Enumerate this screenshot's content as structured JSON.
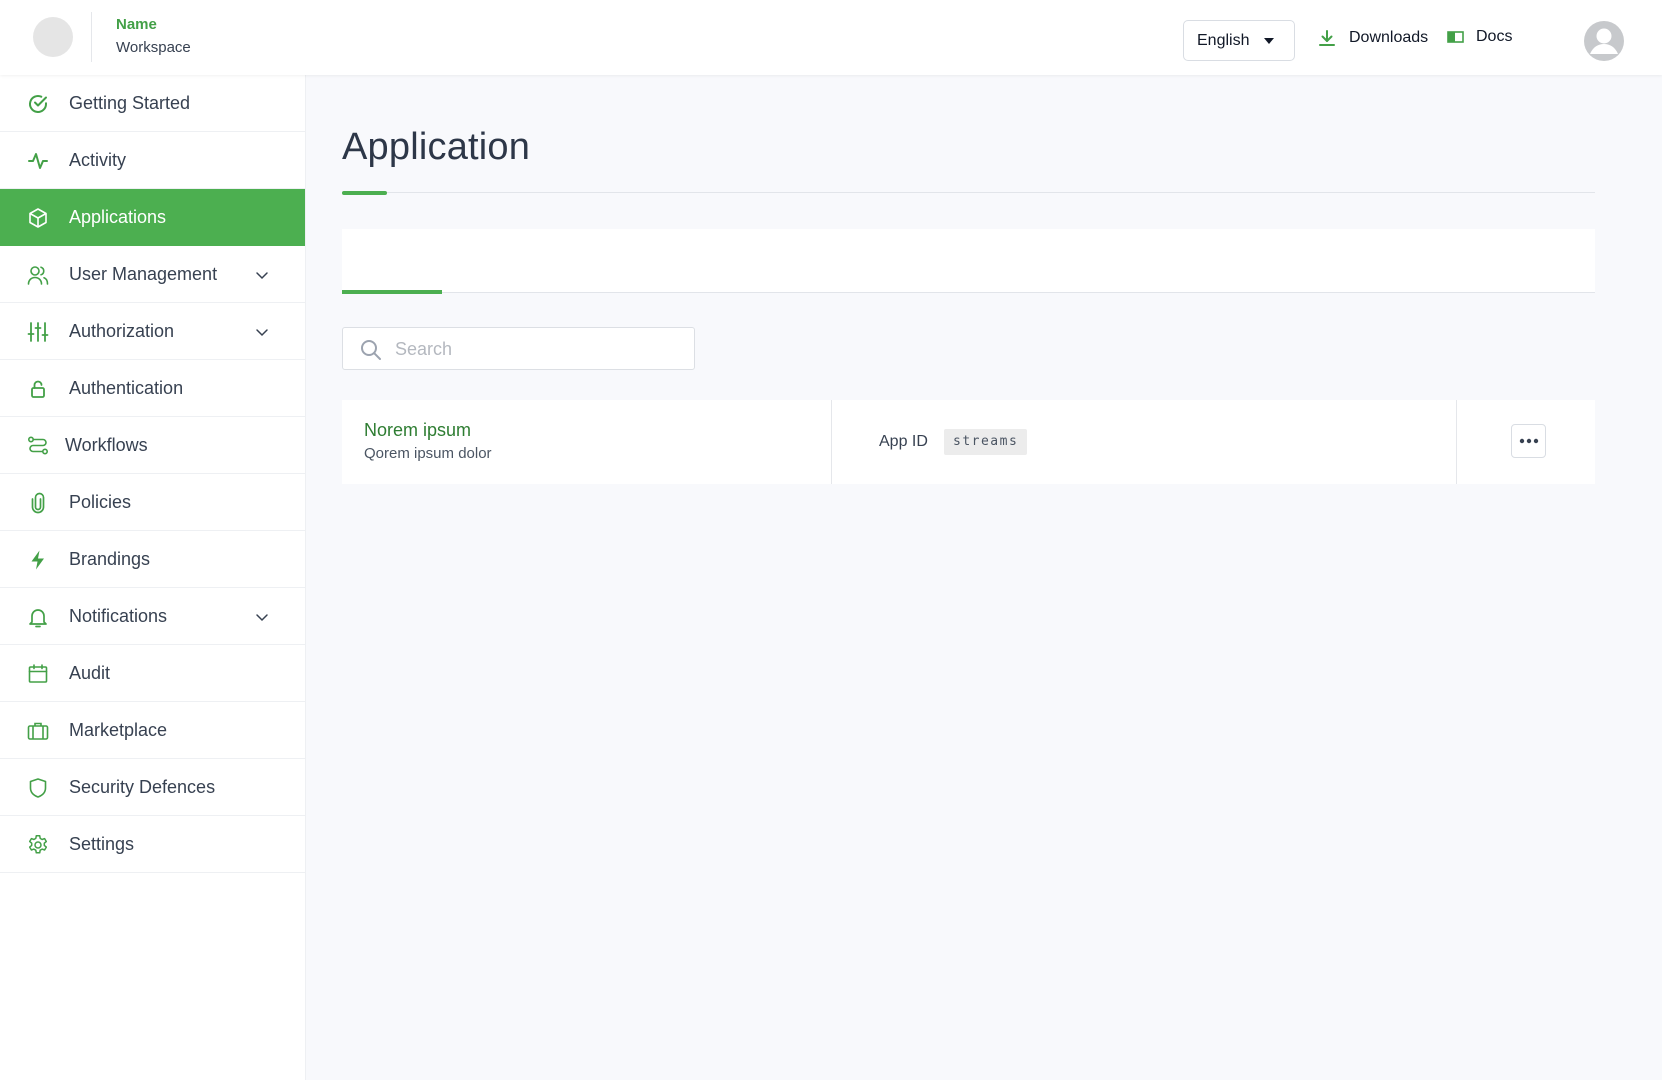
{
  "header": {
    "brand_name": "Name",
    "brand_workspace": "Workspace",
    "language": "English",
    "downloads_label": "Downloads",
    "docs_label": "Docs"
  },
  "sidebar": {
    "items": [
      {
        "label": "Getting Started",
        "icon": "check-circle-icon"
      },
      {
        "label": "Activity",
        "icon": "activity-icon"
      },
      {
        "label": "Applications",
        "icon": "cube-icon",
        "active": true
      },
      {
        "label": "User Management",
        "icon": "users-icon",
        "expandable": true
      },
      {
        "label": "Authorization",
        "icon": "sliders-icon",
        "expandable": true
      },
      {
        "label": "Authentication",
        "icon": "lock-icon"
      },
      {
        "label": "Workflows",
        "icon": "workflow-icon"
      },
      {
        "label": "Policies",
        "icon": "paperclip-icon"
      },
      {
        "label": "Brandings",
        "icon": "lightning-icon"
      },
      {
        "label": "Notifications",
        "icon": "bell-icon",
        "expandable": true
      },
      {
        "label": "Audit",
        "icon": "calendar-icon"
      },
      {
        "label": "Marketplace",
        "icon": "briefcase-icon"
      },
      {
        "label": "Security Defences",
        "icon": "shield-icon"
      },
      {
        "label": "Settings",
        "icon": "gear-icon"
      }
    ]
  },
  "main": {
    "title": "Application",
    "search": {
      "placeholder": "Search",
      "value": ""
    },
    "app": {
      "name": "Norem ipsum",
      "description": "Qorem ipsum dolor",
      "app_id_label": "App ID",
      "app_id_value": "streams"
    }
  },
  "colors": {
    "accent": "#4caf50",
    "accent_dark": "#2e7d32",
    "background": "#f8f9fc"
  }
}
